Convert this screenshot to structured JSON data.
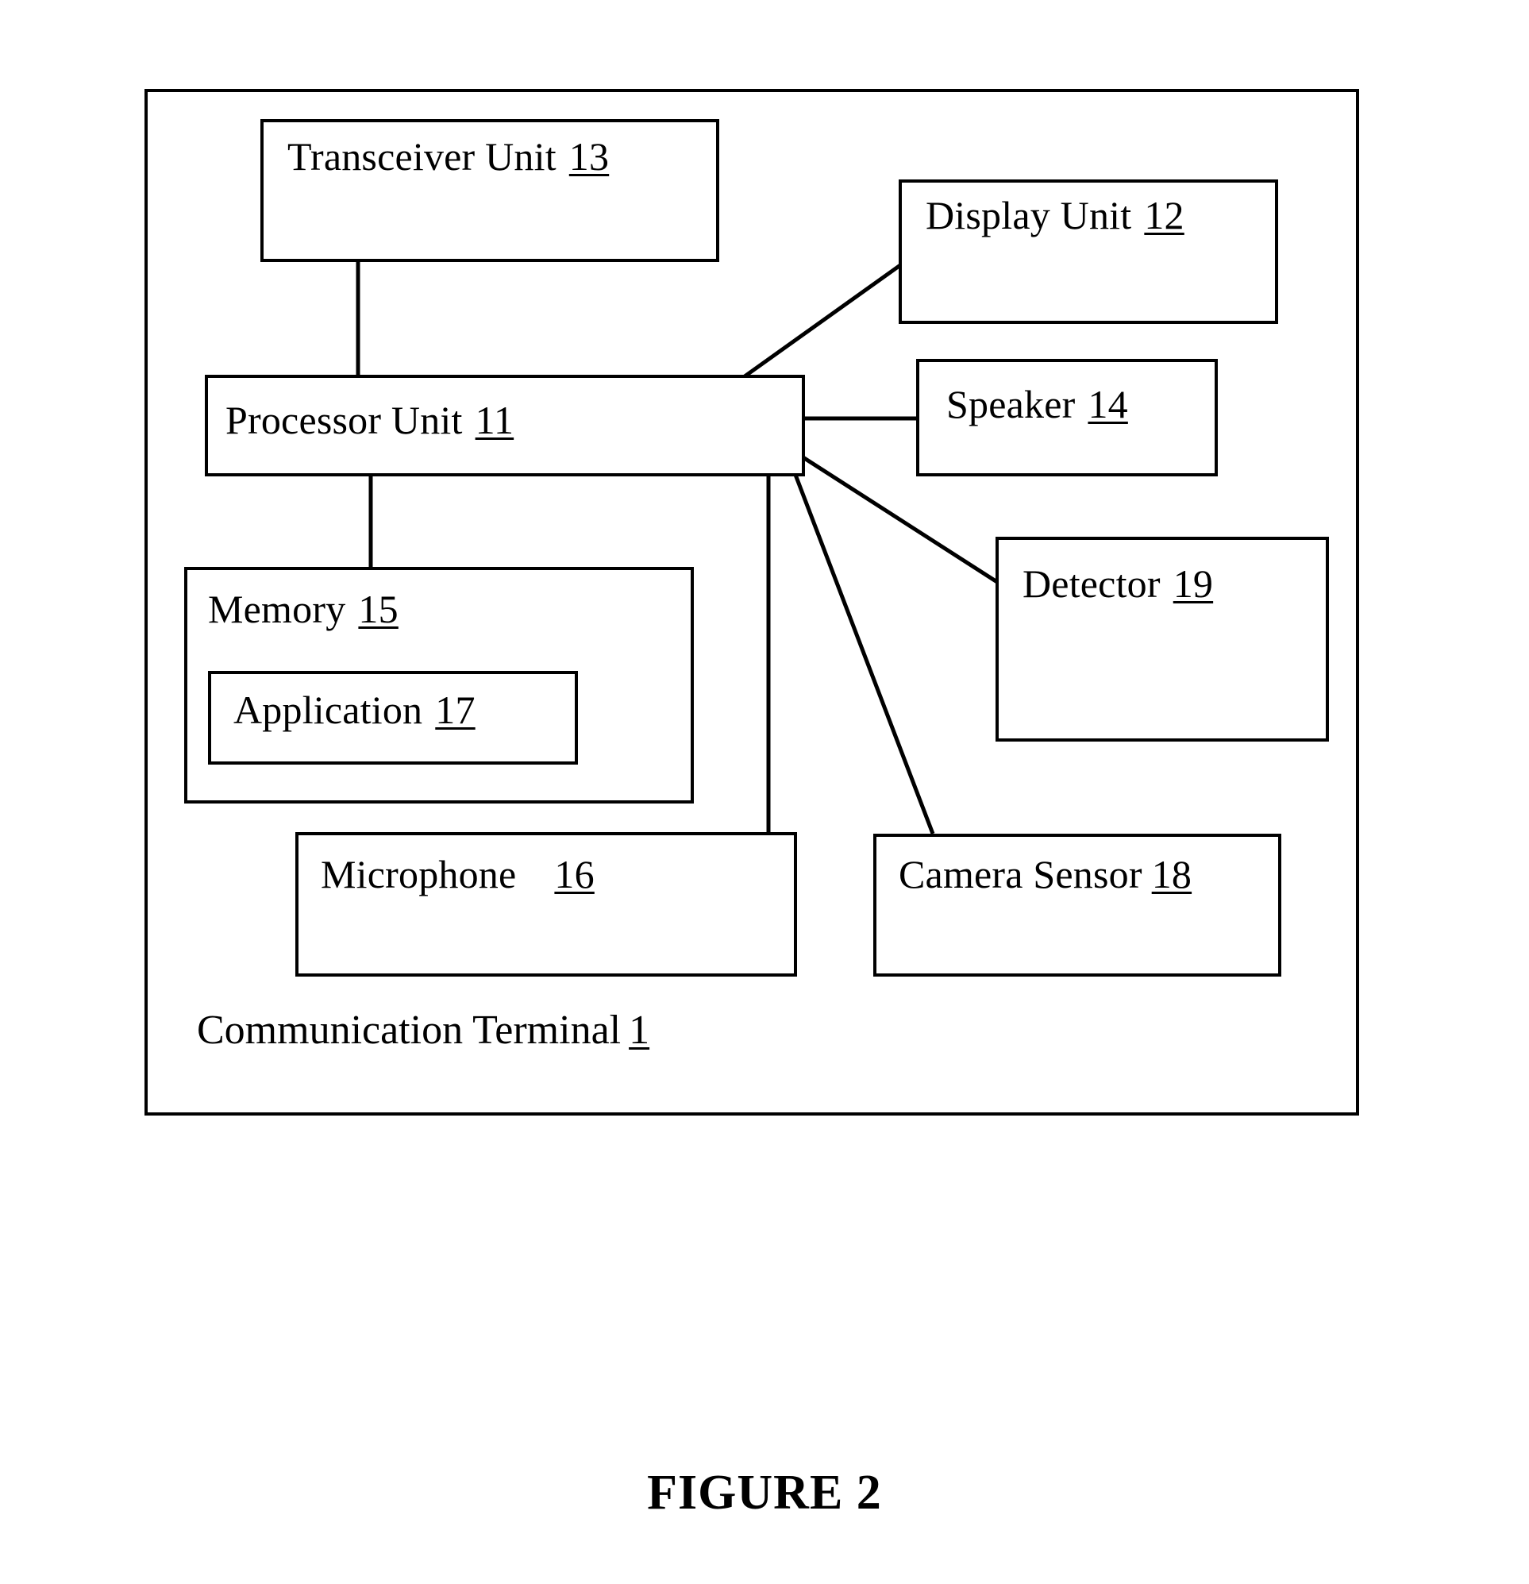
{
  "figure": {
    "caption": "FIGURE 2"
  },
  "terminal": {
    "caption_text": "Communication Terminal",
    "caption_number": "1"
  },
  "nodes": [
    {
      "key": "transceiver",
      "label": "Transceiver Unit",
      "number": "13"
    },
    {
      "key": "display",
      "label": "Display Unit",
      "number": "12"
    },
    {
      "key": "processor",
      "label": "Processor Unit",
      "number": "11"
    },
    {
      "key": "speaker",
      "label": "Speaker",
      "number": "14"
    },
    {
      "key": "detector",
      "label": "Detector",
      "number": "19"
    },
    {
      "key": "memory",
      "label": "Memory",
      "number": "15"
    },
    {
      "key": "application",
      "label": "Application",
      "number": "17"
    },
    {
      "key": "microphone",
      "label": "Microphone",
      "number": "16"
    },
    {
      "key": "camera",
      "label": "Camera Sensor",
      "number": "18"
    }
  ],
  "connections": [
    {
      "from": "processor",
      "to": "transceiver"
    },
    {
      "from": "processor",
      "to": "display"
    },
    {
      "from": "processor",
      "to": "speaker"
    },
    {
      "from": "processor",
      "to": "detector"
    },
    {
      "from": "processor",
      "to": "memory"
    },
    {
      "from": "processor",
      "to": "microphone"
    },
    {
      "from": "processor",
      "to": "camera"
    }
  ],
  "style": {
    "line_color": "#000000",
    "background_color": "#ffffff"
  }
}
